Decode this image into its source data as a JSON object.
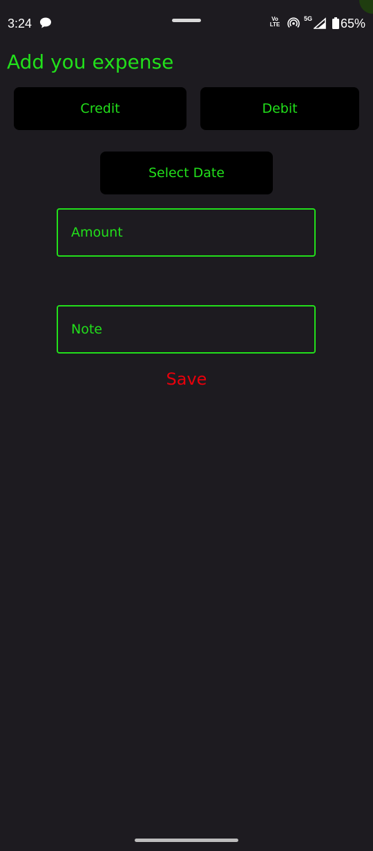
{
  "status_bar": {
    "time": "3:24",
    "network_label": "Vo LTE",
    "network_5g": "5G",
    "battery": "65%",
    "icons": [
      "chat-bubble-icon",
      "volte-icon",
      "hotspot-icon",
      "signal-icon",
      "battery-icon"
    ]
  },
  "page": {
    "title": "Add you expense"
  },
  "buttons": {
    "credit": "Credit",
    "debit": "Debit",
    "select_date": "Select Date"
  },
  "form": {
    "amount": {
      "placeholder": "Amount",
      "value": ""
    },
    "note": {
      "placeholder": "Note",
      "value": ""
    }
  },
  "actions": {
    "save": "Save"
  },
  "colors": {
    "background": "#1d1b20",
    "accent": "#22e01b",
    "danger": "#e8000b",
    "button_bg": "#000000"
  }
}
